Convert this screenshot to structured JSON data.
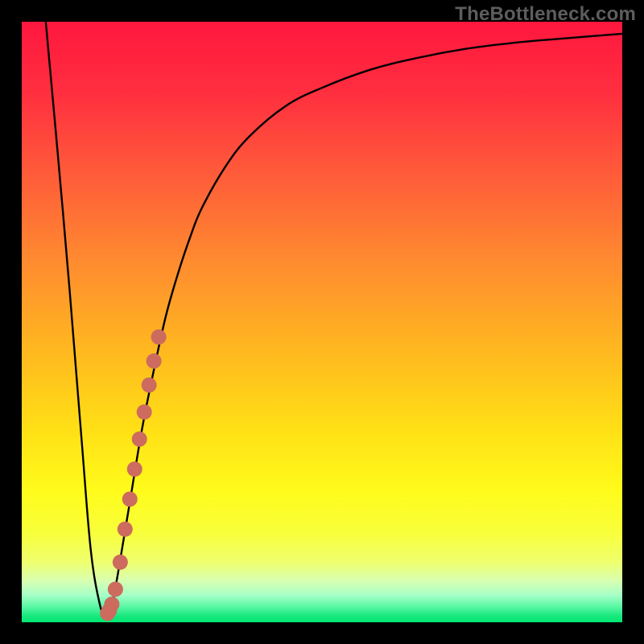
{
  "watermark": "TheBottleneck.com",
  "colors": {
    "frame": "#000000",
    "curve_stroke": "#000000",
    "marker_fill": "#cc6b5e",
    "gradient_stops": [
      {
        "offset": "0%",
        "color": "#ff173e"
      },
      {
        "offset": "12%",
        "color": "#ff2f3f"
      },
      {
        "offset": "25%",
        "color": "#ff5a3a"
      },
      {
        "offset": "40%",
        "color": "#ff8b2f"
      },
      {
        "offset": "55%",
        "color": "#ffb91f"
      },
      {
        "offset": "68%",
        "color": "#ffe016"
      },
      {
        "offset": "78%",
        "color": "#fffb1a"
      },
      {
        "offset": "85%",
        "color": "#f8ff3a"
      },
      {
        "offset": "90%",
        "color": "#efff6e"
      },
      {
        "offset": "93%",
        "color": "#d9ffb0"
      },
      {
        "offset": "95.5%",
        "color": "#a6ffc8"
      },
      {
        "offset": "97.5%",
        "color": "#55f7a1"
      },
      {
        "offset": "99%",
        "color": "#17e87c"
      },
      {
        "offset": "100%",
        "color": "#00e874"
      }
    ]
  },
  "chart_data": {
    "type": "line",
    "title": "",
    "xlabel": "",
    "ylabel": "",
    "xlim": [
      0,
      100
    ],
    "ylim": [
      0,
      100
    ],
    "series": [
      {
        "name": "bottleneck-curve",
        "x": [
          4,
          6,
          8,
          10,
          11.5,
          13,
          14,
          15,
          16,
          18,
          20,
          22,
          24,
          26,
          28,
          30,
          34,
          38,
          44,
          50,
          58,
          66,
          74,
          82,
          90,
          100
        ],
        "y": [
          100,
          78,
          55,
          30,
          12,
          3,
          1,
          3,
          8,
          20,
          32,
          42,
          51,
          58,
          64,
          69,
          76,
          81,
          86,
          89,
          92,
          94,
          95.5,
          96.5,
          97.2,
          98
        ]
      }
    ],
    "markers": {
      "name": "highlight-segment",
      "x": [
        14.3,
        14.6,
        15.0,
        15.6,
        16.4,
        17.2,
        18.0,
        18.8,
        19.6,
        20.4,
        21.2,
        22.0,
        22.8
      ],
      "y": [
        1.5,
        2.0,
        3.0,
        5.5,
        10.0,
        15.5,
        20.5,
        25.5,
        30.5,
        35.0,
        39.5,
        43.5,
        47.5
      ]
    }
  }
}
